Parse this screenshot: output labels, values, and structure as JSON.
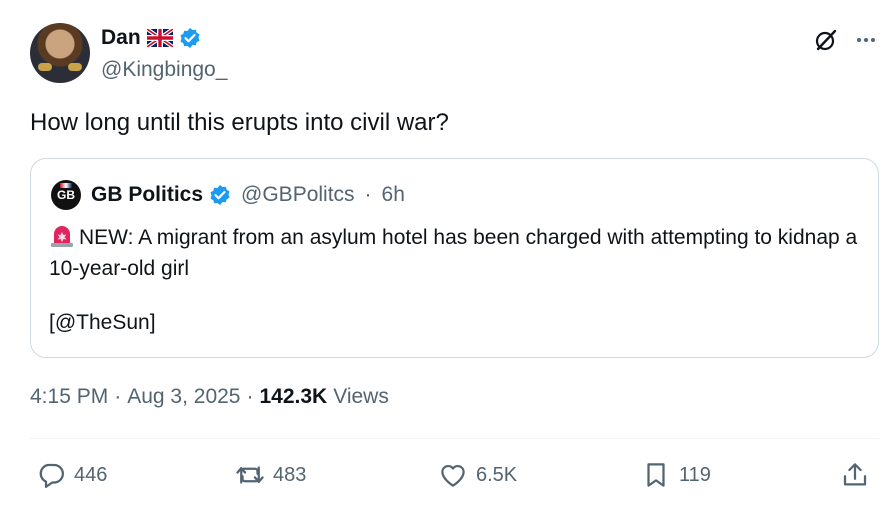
{
  "author": {
    "display_name": "Dan",
    "handle": "@Kingbingo_"
  },
  "tweet": {
    "text": "How long until this erupts into civil war?"
  },
  "quoted": {
    "avatar_text": "GB",
    "display_name": "GB Politics",
    "handle": "@GBPolitcs",
    "separator": "·",
    "time": "6h",
    "body": "NEW: A migrant from an asylum hotel has been charged with attempting to kidnap a 10-year-old girl",
    "source": "[@TheSun]"
  },
  "meta": {
    "time": "4:15 PM",
    "sep1": "·",
    "date": "Aug 3, 2025",
    "sep2": "·",
    "views_count": "142.3K",
    "views_label": "Views"
  },
  "actions": {
    "replies": "446",
    "reposts": "483",
    "likes": "6.5K",
    "bookmarks": "119"
  },
  "colors": {
    "verified": "#1d9bf0",
    "secondary_text": "#536471",
    "border": "#cfd9de"
  },
  "icons": [
    "verified-badge-icon",
    "uk-flag-icon",
    "grok-icon",
    "more-icon",
    "siren-icon",
    "reply-icon",
    "retweet-icon",
    "like-icon",
    "bookmark-icon",
    "share-icon"
  ]
}
